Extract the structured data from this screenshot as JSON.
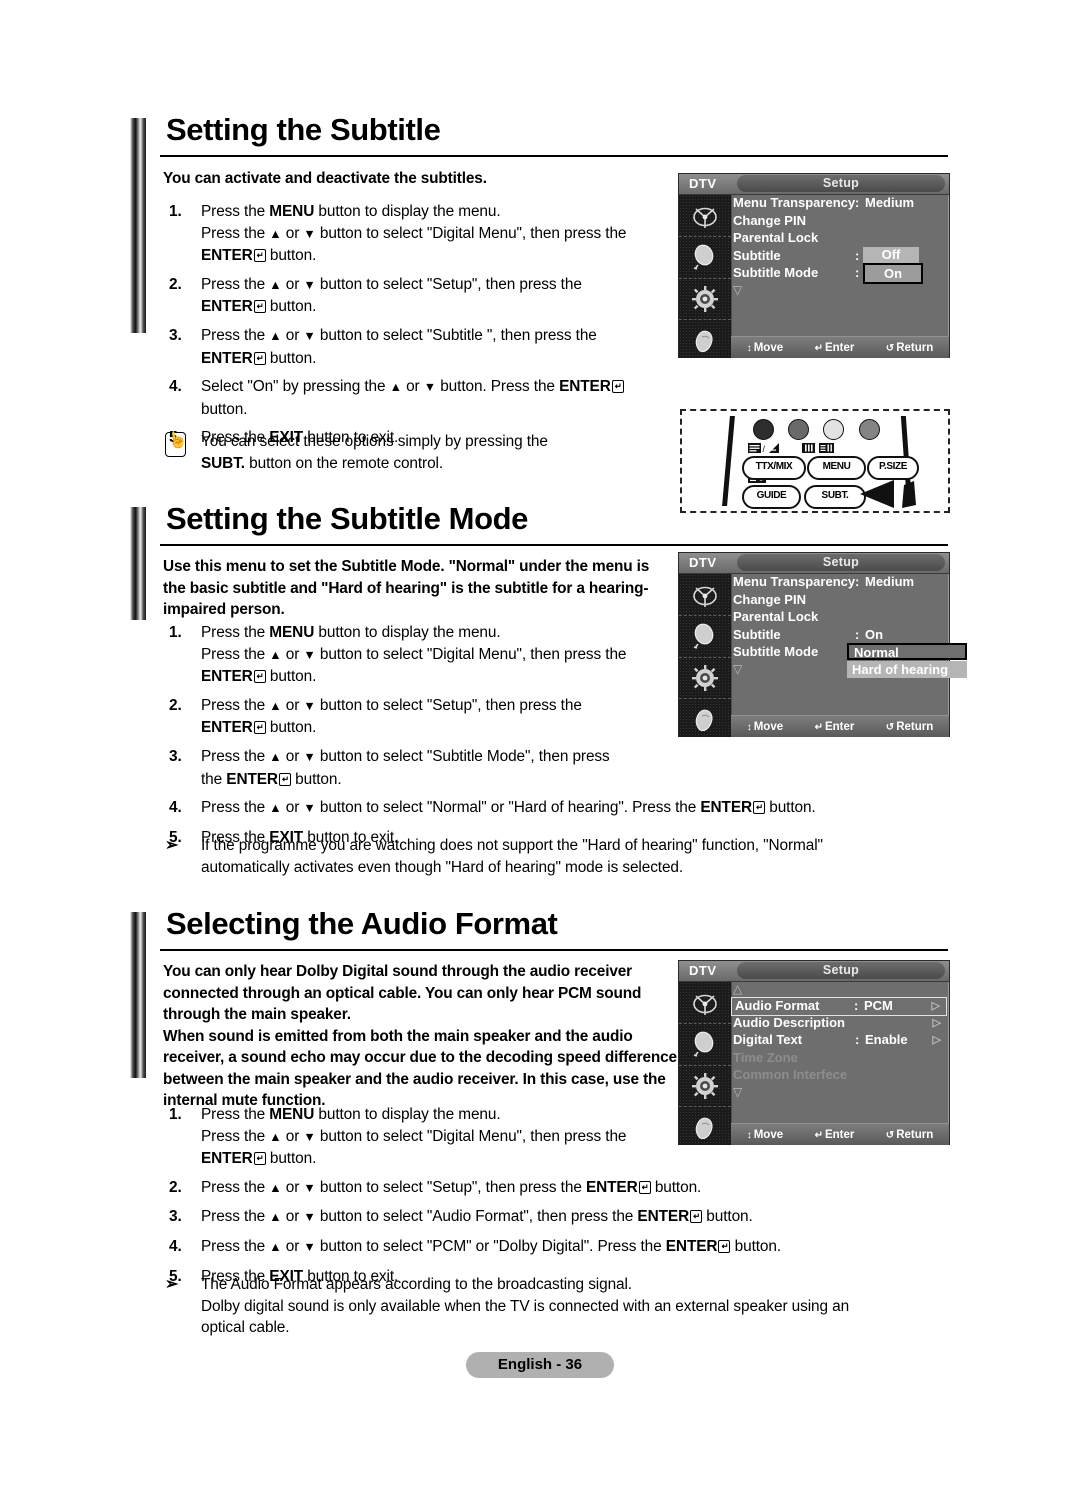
{
  "page": {
    "footer_label": "English - 36"
  },
  "sections": [
    {
      "id": "subtitle",
      "title": "Setting the Subtitle",
      "intro": "You can activate and deactivate the subtitles.",
      "steps": [
        {
          "num": "1.",
          "parts": [
            {
              "t": "Press the "
            },
            {
              "t": "MENU",
              "b": true
            },
            {
              "t": " button to display the menu."
            },
            {
              "br": true
            },
            {
              "t": "Press the "
            },
            {
              "t": "▲",
              "g": "up"
            },
            {
              "t": " or "
            },
            {
              "t": "▼",
              "g": "dn"
            },
            {
              "t": " button to select \"Digital Menu\", then press the"
            },
            {
              "br": true
            },
            {
              "t": "ENTER",
              "b": true
            },
            {
              "enter": true
            },
            {
              "t": " button."
            }
          ]
        },
        {
          "num": "2.",
          "parts": [
            {
              "t": "Press the "
            },
            {
              "t": "▲",
              "g": "up"
            },
            {
              "t": " or "
            },
            {
              "t": "▼",
              "g": "dn"
            },
            {
              "t": " button to select \"Setup\", then press the"
            },
            {
              "br": true
            },
            {
              "t": "ENTER",
              "b": true
            },
            {
              "enter": true
            },
            {
              "t": " button."
            }
          ]
        },
        {
          "num": "3.",
          "parts": [
            {
              "t": "Press the "
            },
            {
              "t": "▲",
              "g": "up"
            },
            {
              "t": " or "
            },
            {
              "t": "▼",
              "g": "dn"
            },
            {
              "t": " button to select \"Subtitle \", then press the"
            },
            {
              "br": true
            },
            {
              "t": "ENTER",
              "b": true
            },
            {
              "enter": true
            },
            {
              "t": " button."
            }
          ]
        },
        {
          "num": "4.",
          "parts": [
            {
              "t": "Select \"On\" by pressing the "
            },
            {
              "t": "▲",
              "g": "up"
            },
            {
              "t": " or "
            },
            {
              "t": "▼",
              "g": "dn"
            },
            {
              "t": " button. Press the "
            },
            {
              "t": "ENTER",
              "b": true
            },
            {
              "enter": true
            },
            {
              "br": true
            },
            {
              "t": "button."
            }
          ]
        },
        {
          "num": "5.",
          "parts": [
            {
              "t": "Press the "
            },
            {
              "t": "EXIT",
              "b": true
            },
            {
              "t": " button to exit."
            }
          ]
        }
      ],
      "notes": [
        {
          "mark": "hand",
          "parts": [
            {
              "t": "You can select these options simply by pressing the"
            },
            {
              "br": true
            },
            {
              "t": "SUBT.",
              "b": true
            },
            {
              "t": " button on the remote control."
            }
          ]
        }
      ]
    },
    {
      "id": "subtitle-mode",
      "title": "Setting the Subtitle Mode",
      "intro": "Use this menu to set the Subtitle Mode. \"Normal\" under the menu is the basic subtitle and \"Hard of hearing\" is the subtitle for a hearing-impaired person.",
      "steps": [
        {
          "num": "1.",
          "parts": [
            {
              "t": "Press the "
            },
            {
              "t": "MENU",
              "b": true
            },
            {
              "t": " button to display the menu."
            },
            {
              "br": true
            },
            {
              "t": "Press the "
            },
            {
              "t": "▲",
              "g": "up"
            },
            {
              "t": " or "
            },
            {
              "t": "▼",
              "g": "dn"
            },
            {
              "t": " button to select \"Digital Menu\", then press the"
            },
            {
              "br": true
            },
            {
              "t": "ENTER",
              "b": true
            },
            {
              "enter": true
            },
            {
              "t": " button."
            }
          ]
        },
        {
          "num": "2.",
          "parts": [
            {
              "t": "Press the "
            },
            {
              "t": "▲",
              "g": "up"
            },
            {
              "t": " or "
            },
            {
              "t": "▼",
              "g": "dn"
            },
            {
              "t": " button to select \"Setup\", then press the"
            },
            {
              "br": true
            },
            {
              "t": "ENTER",
              "b": true
            },
            {
              "enter": true
            },
            {
              "t": " button."
            }
          ]
        },
        {
          "num": "3.",
          "parts": [
            {
              "t": "Press the "
            },
            {
              "t": "▲",
              "g": "up"
            },
            {
              "t": " or "
            },
            {
              "t": "▼",
              "g": "dn"
            },
            {
              "t": " button to select \"Subtitle  Mode\", then press"
            },
            {
              "br": true
            },
            {
              "t": "the "
            },
            {
              "t": "ENTER",
              "b": true
            },
            {
              "enter": true
            },
            {
              "t": " button."
            }
          ]
        },
        {
          "num": "4.",
          "parts": [
            {
              "t": "Press the "
            },
            {
              "t": "▲",
              "g": "up"
            },
            {
              "t": " or "
            },
            {
              "t": "▼",
              "g": "dn"
            },
            {
              "t": " button to select \"Normal\" or \"Hard of hearing\". Press the "
            },
            {
              "t": "ENTER",
              "b": true
            },
            {
              "enter": true
            },
            {
              "t": " button."
            }
          ]
        },
        {
          "num": "5.",
          "parts": [
            {
              "t": "Press the "
            },
            {
              "t": "EXIT",
              "b": true
            },
            {
              "t": " button to exit."
            }
          ]
        }
      ],
      "notes": [
        {
          "mark": "tri",
          "parts": [
            {
              "t": "If the programme you are watching does not support the \"Hard of hearing\" function, \"Normal\""
            },
            {
              "br": true
            },
            {
              "t": "automatically activates even though \"Hard of hearing\" mode is selected."
            }
          ]
        }
      ]
    },
    {
      "id": "audio-format",
      "title": "Selecting the Audio Format",
      "intro": "You can only hear Dolby Digital sound through the audio receiver connected through an optical cable. You can only hear PCM sound through the main speaker.\nWhen sound is emitted from both the main speaker and the audio receiver, a sound echo may occur due to the decoding speed difference between the main speaker and the audio receiver. In this case, use the internal mute function.",
      "steps": [
        {
          "num": "1.",
          "parts": [
            {
              "t": "Press the "
            },
            {
              "t": "MENU",
              "b": true
            },
            {
              "t": " button to display the menu."
            },
            {
              "br": true
            },
            {
              "t": "Press the "
            },
            {
              "t": "▲",
              "g": "up"
            },
            {
              "t": " or "
            },
            {
              "t": "▼",
              "g": "dn"
            },
            {
              "t": " button to select \"Digital Menu\", then press the"
            },
            {
              "br": true
            },
            {
              "t": "ENTER",
              "b": true
            },
            {
              "enter": true
            },
            {
              "t": " button."
            }
          ]
        },
        {
          "num": "2.",
          "parts": [
            {
              "t": "Press the "
            },
            {
              "t": "▲",
              "g": "up"
            },
            {
              "t": " or "
            },
            {
              "t": "▼",
              "g": "dn"
            },
            {
              "t": " button to select \"Setup\", then press the "
            },
            {
              "t": "ENTER",
              "b": true
            },
            {
              "enter": true
            },
            {
              "t": " button."
            }
          ]
        },
        {
          "num": "3.",
          "parts": [
            {
              "t": "Press the "
            },
            {
              "t": "▲",
              "g": "up"
            },
            {
              "t": " or "
            },
            {
              "t": "▼",
              "g": "dn"
            },
            {
              "t": " button to select \"Audio Format\", then press the "
            },
            {
              "t": "ENTER",
              "b": true
            },
            {
              "enter": true
            },
            {
              "t": " button."
            }
          ]
        },
        {
          "num": "4.",
          "parts": [
            {
              "t": "Press the "
            },
            {
              "t": "▲",
              "g": "up"
            },
            {
              "t": " or "
            },
            {
              "t": "▼",
              "g": "dn"
            },
            {
              "t": " button to select \"PCM\" or \"Dolby Digital\". Press the "
            },
            {
              "t": "ENTER",
              "b": true
            },
            {
              "enter": true
            },
            {
              "t": " button."
            }
          ]
        },
        {
          "num": "5.",
          "parts": [
            {
              "t": "Press the "
            },
            {
              "t": "EXIT",
              "b": true
            },
            {
              "t": " button to exit."
            }
          ]
        }
      ],
      "notes": [
        {
          "mark": "tri",
          "parts": [
            {
              "t": "The Audio Format appears according to the broadcasting signal."
            },
            {
              "br": true
            },
            {
              "t": "Dolby digital sound is only available when the TV is connected with an external speaker using an"
            },
            {
              "br": true
            },
            {
              "t": "optical cable."
            }
          ]
        }
      ]
    }
  ],
  "osd_menus": [
    {
      "id": "osd-subtitle",
      "source_label": "DTV",
      "tab_label": "Setup",
      "items": [
        {
          "label": "Menu Transparency",
          "colon": ":",
          "value": "Medium"
        },
        {
          "label": "Change PIN"
        },
        {
          "label": "Parental Lock"
        },
        {
          "label": "Subtitle",
          "colon": ":"
        },
        {
          "label": "Subtitle  Mode",
          "colon": ":"
        }
      ],
      "dropdown": {
        "unselected": "Off",
        "selected": "On"
      },
      "scroll_down": "▽",
      "hints": [
        {
          "glyph": "↕",
          "label": "Move"
        },
        {
          "glyph": "↵",
          "label": "Enter"
        },
        {
          "glyph": "↺",
          "label": "Return"
        }
      ]
    },
    {
      "id": "osd-subtitle-mode",
      "source_label": "DTV",
      "tab_label": "Setup",
      "items": [
        {
          "label": "Menu Transparency",
          "colon": ":",
          "value": "Medium"
        },
        {
          "label": "Change PIN"
        },
        {
          "label": "Parental Lock"
        },
        {
          "label": "Subtitle",
          "colon": ":",
          "value": "On"
        },
        {
          "label": "Subtitle  Mode"
        }
      ],
      "dropdown": {
        "selected": "Normal",
        "unselected": "Hard of hearing"
      },
      "scroll_down": "▽",
      "hints": [
        {
          "glyph": "↕",
          "label": "Move"
        },
        {
          "glyph": "↵",
          "label": "Enter"
        },
        {
          "glyph": "↺",
          "label": "Return"
        }
      ]
    },
    {
      "id": "osd-audio-format",
      "source_label": "DTV",
      "tab_label": "Setup",
      "scroll_up": "△",
      "items": [
        {
          "label": "Audio Format",
          "colon": ":",
          "value": "PCM",
          "caret": "▷",
          "highlight": true
        },
        {
          "label": "Audio Description",
          "caret": "▷"
        },
        {
          "label": "Digital Text",
          "colon": ":",
          "value": "Enable",
          "caret": "▷"
        },
        {
          "label": "Time Zone",
          "dim": true
        },
        {
          "label": "Common Interfece",
          "dim": true
        }
      ],
      "scroll_down": "▽",
      "hints": [
        {
          "glyph": "↕",
          "label": "Move"
        },
        {
          "glyph": "↵",
          "label": "Enter"
        },
        {
          "glyph": "↺",
          "label": "Return"
        }
      ]
    }
  ],
  "remote": {
    "buttons": [
      {
        "label": "TTX/MIX"
      },
      {
        "label": "MENU"
      },
      {
        "label": "P.SIZE"
      },
      {
        "label": "GUIDE"
      },
      {
        "label": "SUBT."
      }
    ]
  }
}
